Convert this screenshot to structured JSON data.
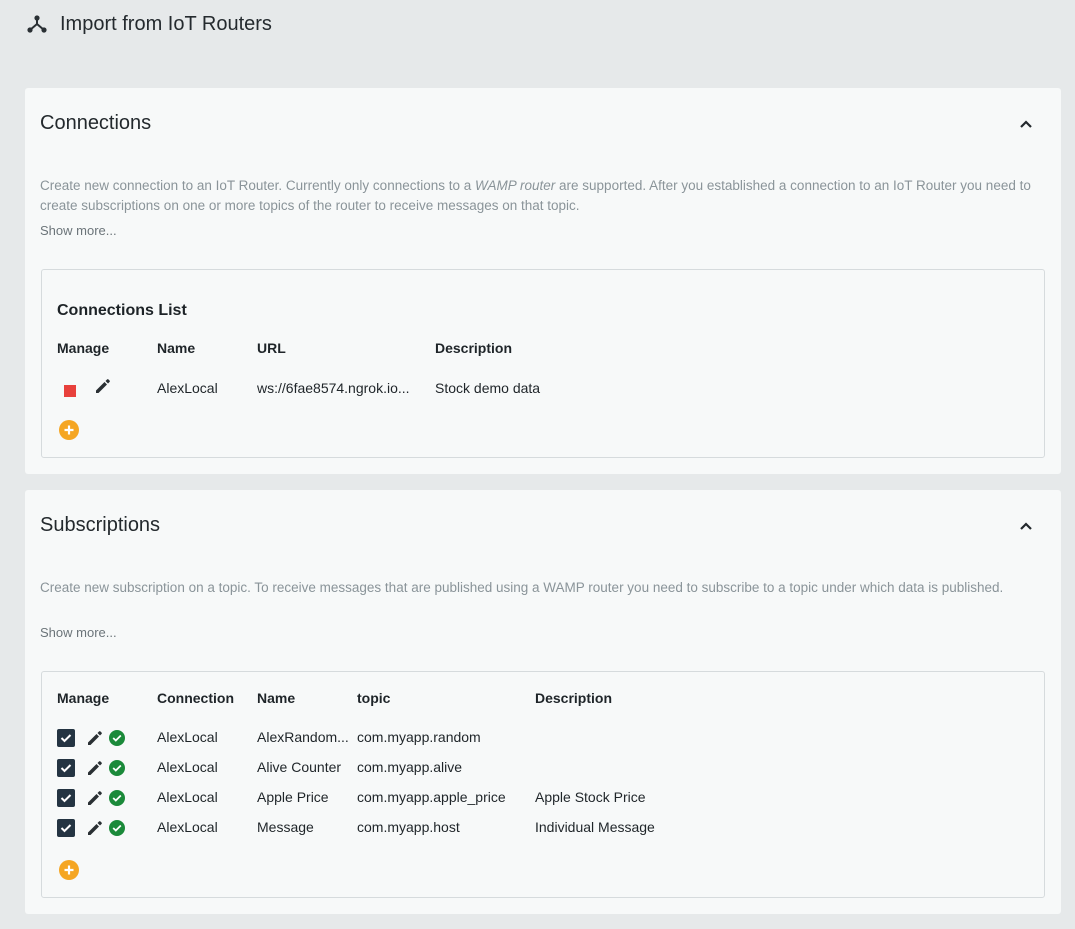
{
  "header": {
    "title": "Import from IoT Routers",
    "icon": "hub-icon"
  },
  "connections": {
    "title": "Connections",
    "description_before": "Create new connection to an IoT Router. Currently only connections to a ",
    "description_em": "WAMP router",
    "description_after": " are supported. After you established a connection to an IoT Router you need to create subscriptions on one or more topics of the router to receive messages on that topic.",
    "show_more": "Show more...",
    "list_title": "Connections List",
    "columns": [
      "Manage",
      "Name",
      "URL",
      "Description"
    ],
    "rows": [
      {
        "name": "AlexLocal",
        "url": "ws://6fae8574.ngrok.io...",
        "description": "Stock demo data",
        "status_color": "#e8413c"
      }
    ]
  },
  "subscriptions": {
    "title": "Subscriptions",
    "description": "Create new subscription on a topic. To receive messages that are published using a WAMP router you need to subscribe to a topic under which data is published.",
    "show_more": "Show more...",
    "columns": [
      "Manage",
      "Connection",
      "Name",
      "topic",
      "Description"
    ],
    "rows": [
      {
        "connection": "AlexLocal",
        "name": "AlexRandom...",
        "topic": "com.myapp.random",
        "description": ""
      },
      {
        "connection": "AlexLocal",
        "name": "Alive Counter",
        "topic": "com.myapp.alive",
        "description": ""
      },
      {
        "connection": "AlexLocal",
        "name": "Apple Price",
        "topic": "com.myapp.apple_price",
        "description": "Apple Stock Price"
      },
      {
        "connection": "AlexLocal",
        "name": "Message",
        "topic": "com.myapp.host",
        "description": "Individual Message"
      }
    ]
  },
  "colors": {
    "accent_add": "#f5a623",
    "checkbox": "#243442",
    "status_ok": "#1b8a3a",
    "status_stop": "#e8413c"
  }
}
